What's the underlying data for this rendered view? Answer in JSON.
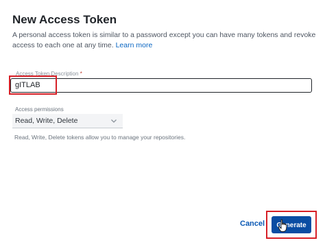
{
  "dialog": {
    "title": "New Access Token",
    "description": "A personal access token is similar to a password except you can have many tokens and revoke access to each one at any time.",
    "learn_more": "Learn more"
  },
  "token_field": {
    "label": "Access Token Description",
    "required_mark": "*",
    "value": "gITLAB"
  },
  "permissions": {
    "label": "Access permissions",
    "selected": "Read, Write, Delete",
    "help": "Read, Write, Delete tokens allow you to manage your repositories."
  },
  "footer": {
    "cancel_label": "Cancel",
    "generate_label": "Generate"
  },
  "colors": {
    "accent": "#0a4da3",
    "link": "#0a66c2",
    "highlight": "#d61f26"
  },
  "icons": {
    "select_chevron": "chevron-down-icon",
    "cursor": "hand-pointer-icon"
  }
}
